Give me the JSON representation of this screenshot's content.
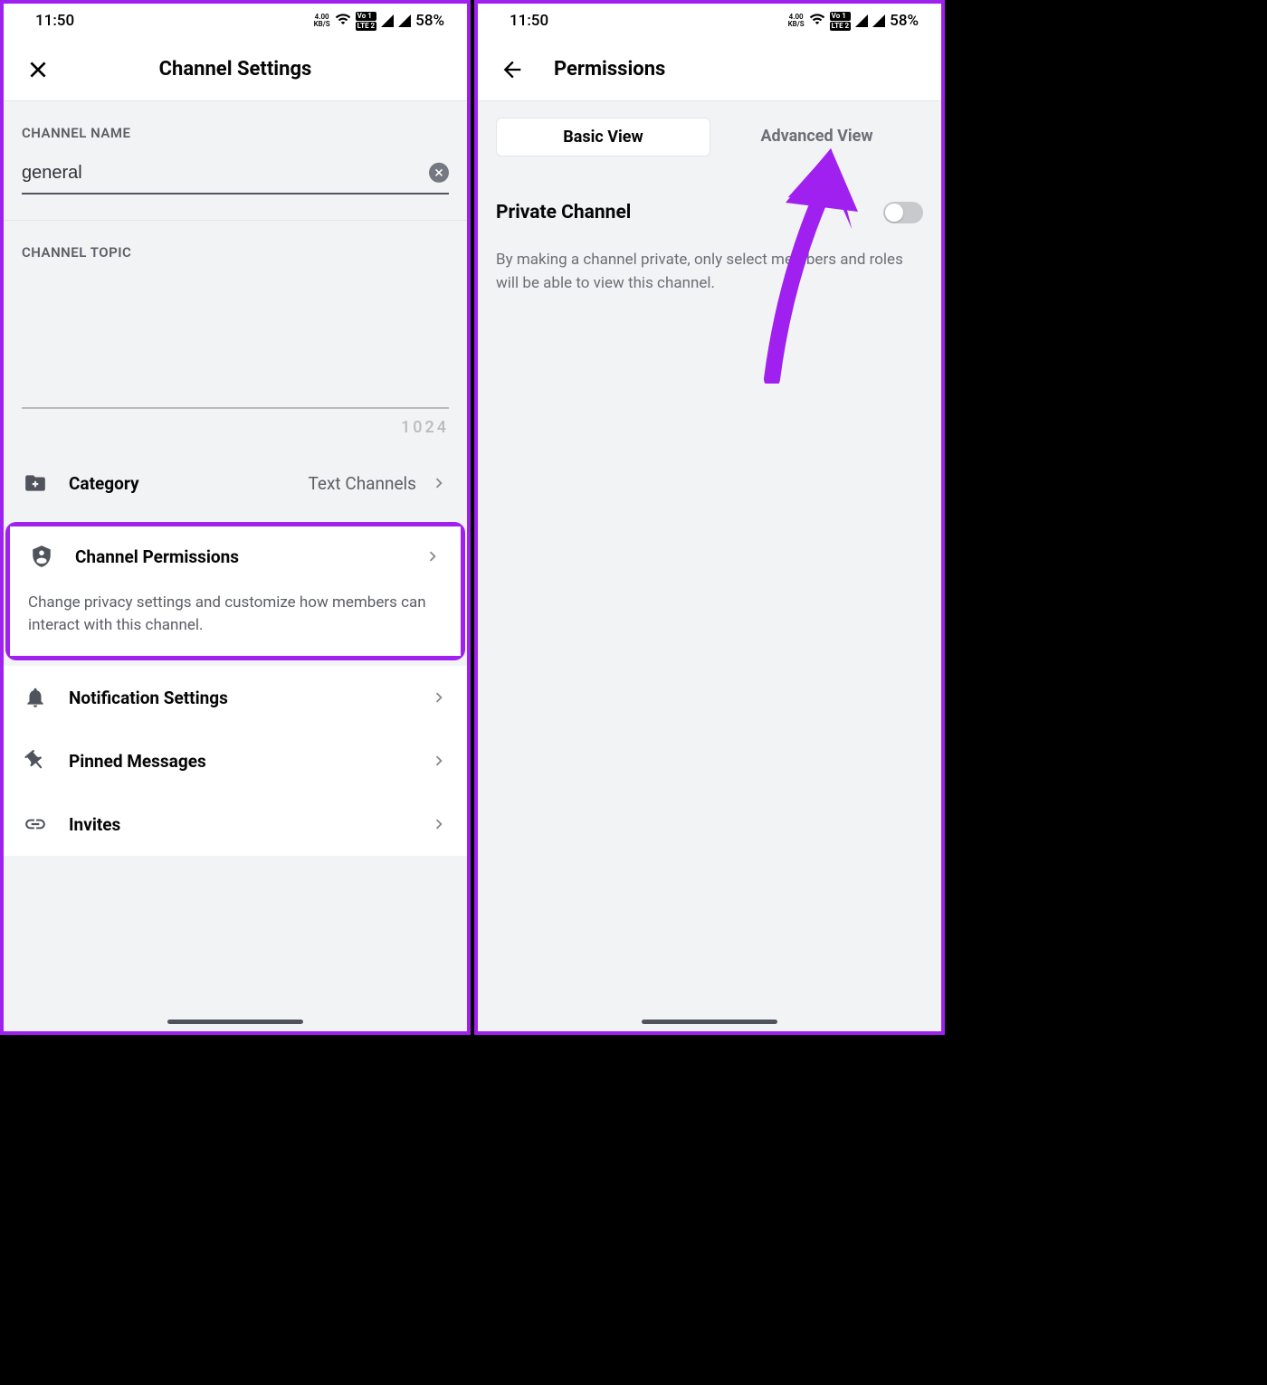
{
  "statusbar": {
    "time": "11:50",
    "kbs_value": "4.00",
    "kbs_label": "KB/S",
    "lte1": "Vo 1",
    "lte2": "LTE 2",
    "battery": "58%"
  },
  "left": {
    "title": "Channel Settings",
    "channel_name_label": "CHANNEL NAME",
    "channel_name_value": "general",
    "channel_topic_label": "CHANNEL TOPIC",
    "topic_charcount": "1024",
    "rows": {
      "category": {
        "label": "Category",
        "value": "Text Channels"
      },
      "permissions": {
        "label": "Channel Permissions",
        "desc": "Change privacy settings and customize how members can interact with this channel."
      },
      "notifications": {
        "label": "Notification Settings"
      },
      "pinned": {
        "label": "Pinned Messages"
      },
      "invites": {
        "label": "Invites"
      }
    }
  },
  "right": {
    "title": "Permissions",
    "tabs": {
      "basic": "Basic View",
      "advanced": "Advanced View"
    },
    "private": {
      "label": "Private Channel",
      "desc": "By making a channel private, only select members and roles will be able to view this channel."
    }
  }
}
